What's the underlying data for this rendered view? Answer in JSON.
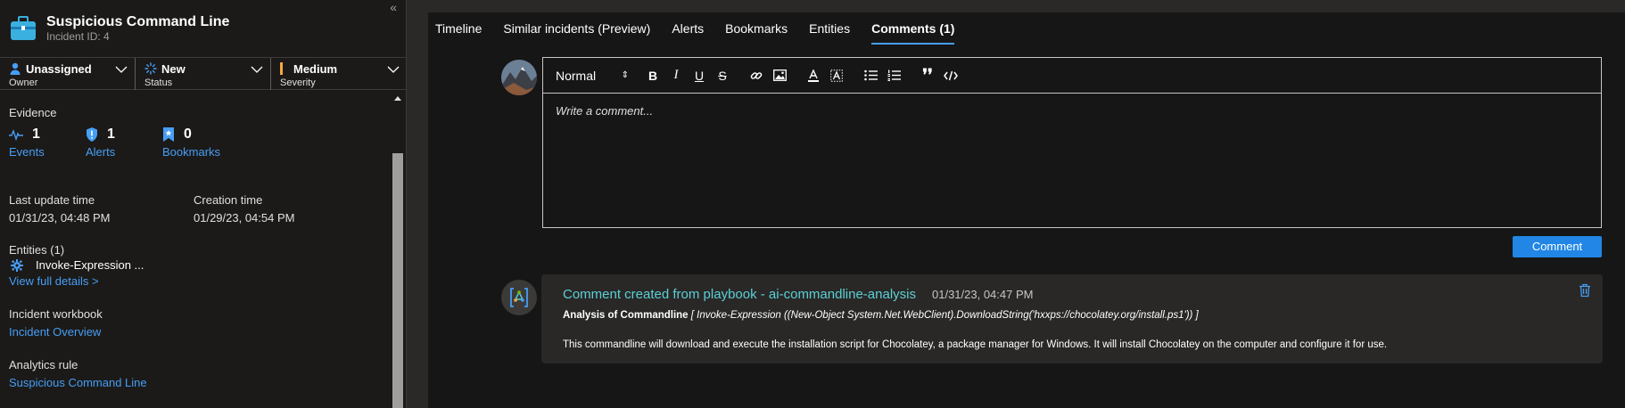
{
  "incident": {
    "title": "Suspicious Command Line",
    "id_label": "Incident ID: 4"
  },
  "fields": {
    "owner": {
      "value": "Unassigned",
      "label": "Owner"
    },
    "status": {
      "value": "New",
      "label": "Status"
    },
    "severity": {
      "value": "Medium",
      "label": "Severity",
      "color": "#f7a83e"
    }
  },
  "evidence": {
    "heading": "Evidence",
    "events": {
      "count": "1",
      "label": "Events"
    },
    "alerts": {
      "count": "1",
      "label": "Alerts"
    },
    "bookmarks": {
      "count": "0",
      "label": "Bookmarks"
    }
  },
  "times": {
    "last_update_label": "Last update time",
    "last_update_value": "01/31/23, 04:48 PM",
    "creation_label": "Creation time",
    "creation_value": "01/29/23, 04:54 PM"
  },
  "entities": {
    "heading": "Entities (1)",
    "item": "Invoke-Expression ...",
    "view_link": "View full details >"
  },
  "workbook": {
    "heading": "Incident workbook",
    "link": "Incident Overview"
  },
  "analytics": {
    "heading": "Analytics rule",
    "link": "Suspicious Command Line"
  },
  "tabs": [
    {
      "label": "Timeline"
    },
    {
      "label": "Similar incidents (Preview)"
    },
    {
      "label": "Alerts"
    },
    {
      "label": "Bookmarks"
    },
    {
      "label": "Entities"
    },
    {
      "label": "Comments (1)"
    }
  ],
  "editor": {
    "format_select": "Normal",
    "placeholder": "Write a comment...",
    "submit_label": "Comment"
  },
  "comment": {
    "title": "Comment created from playbook - ai-commandline-analysis",
    "time": "01/31/23, 04:47 PM",
    "analysis_label": "Analysis of Commandline",
    "analysis_value": "[ Invoke-Expression ((New-Object System.Net.WebClient).DownloadString('hxxps://chocolatey.org/install.ps1')) ]",
    "body": "This commandline will download and execute the installation script for Chocolatey, a package manager for Windows. It will install Chocolatey on the computer and configure it for use."
  },
  "colors": {
    "accent": "#479ef5",
    "button": "#2186e6",
    "comment_title": "#5bd0d6"
  }
}
